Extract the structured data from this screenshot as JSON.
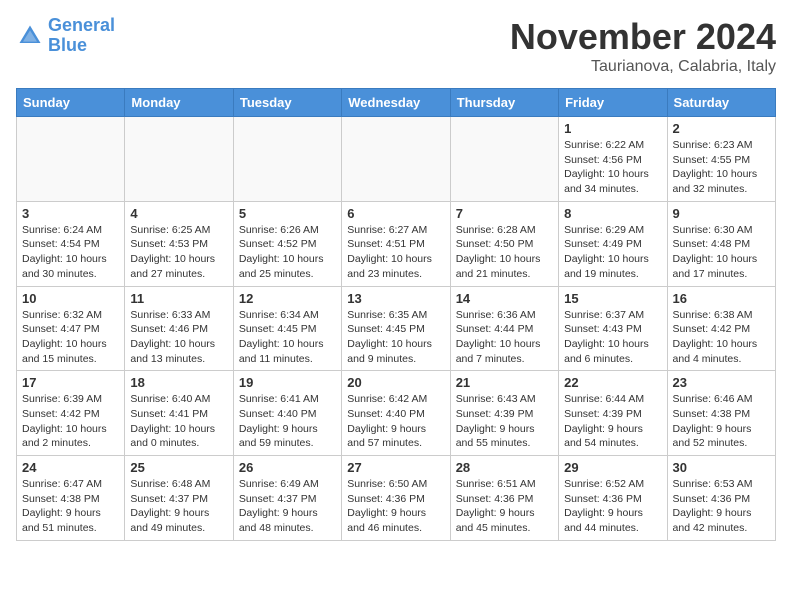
{
  "logo": {
    "line1": "General",
    "line2": "Blue"
  },
  "title": "November 2024",
  "subtitle": "Taurianova, Calabria, Italy",
  "weekdays": [
    "Sunday",
    "Monday",
    "Tuesday",
    "Wednesday",
    "Thursday",
    "Friday",
    "Saturday"
  ],
  "weeks": [
    [
      {
        "day": "",
        "sunrise": "",
        "sunset": "",
        "daylight": ""
      },
      {
        "day": "",
        "sunrise": "",
        "sunset": "",
        "daylight": ""
      },
      {
        "day": "",
        "sunrise": "",
        "sunset": "",
        "daylight": ""
      },
      {
        "day": "",
        "sunrise": "",
        "sunset": "",
        "daylight": ""
      },
      {
        "day": "",
        "sunrise": "",
        "sunset": "",
        "daylight": ""
      },
      {
        "day": "1",
        "sunrise": "Sunrise: 6:22 AM",
        "sunset": "Sunset: 4:56 PM",
        "daylight": "Daylight: 10 hours and 34 minutes."
      },
      {
        "day": "2",
        "sunrise": "Sunrise: 6:23 AM",
        "sunset": "Sunset: 4:55 PM",
        "daylight": "Daylight: 10 hours and 32 minutes."
      }
    ],
    [
      {
        "day": "3",
        "sunrise": "Sunrise: 6:24 AM",
        "sunset": "Sunset: 4:54 PM",
        "daylight": "Daylight: 10 hours and 30 minutes."
      },
      {
        "day": "4",
        "sunrise": "Sunrise: 6:25 AM",
        "sunset": "Sunset: 4:53 PM",
        "daylight": "Daylight: 10 hours and 27 minutes."
      },
      {
        "day": "5",
        "sunrise": "Sunrise: 6:26 AM",
        "sunset": "Sunset: 4:52 PM",
        "daylight": "Daylight: 10 hours and 25 minutes."
      },
      {
        "day": "6",
        "sunrise": "Sunrise: 6:27 AM",
        "sunset": "Sunset: 4:51 PM",
        "daylight": "Daylight: 10 hours and 23 minutes."
      },
      {
        "day": "7",
        "sunrise": "Sunrise: 6:28 AM",
        "sunset": "Sunset: 4:50 PM",
        "daylight": "Daylight: 10 hours and 21 minutes."
      },
      {
        "day": "8",
        "sunrise": "Sunrise: 6:29 AM",
        "sunset": "Sunset: 4:49 PM",
        "daylight": "Daylight: 10 hours and 19 minutes."
      },
      {
        "day": "9",
        "sunrise": "Sunrise: 6:30 AM",
        "sunset": "Sunset: 4:48 PM",
        "daylight": "Daylight: 10 hours and 17 minutes."
      }
    ],
    [
      {
        "day": "10",
        "sunrise": "Sunrise: 6:32 AM",
        "sunset": "Sunset: 4:47 PM",
        "daylight": "Daylight: 10 hours and 15 minutes."
      },
      {
        "day": "11",
        "sunrise": "Sunrise: 6:33 AM",
        "sunset": "Sunset: 4:46 PM",
        "daylight": "Daylight: 10 hours and 13 minutes."
      },
      {
        "day": "12",
        "sunrise": "Sunrise: 6:34 AM",
        "sunset": "Sunset: 4:45 PM",
        "daylight": "Daylight: 10 hours and 11 minutes."
      },
      {
        "day": "13",
        "sunrise": "Sunrise: 6:35 AM",
        "sunset": "Sunset: 4:45 PM",
        "daylight": "Daylight: 10 hours and 9 minutes."
      },
      {
        "day": "14",
        "sunrise": "Sunrise: 6:36 AM",
        "sunset": "Sunset: 4:44 PM",
        "daylight": "Daylight: 10 hours and 7 minutes."
      },
      {
        "day": "15",
        "sunrise": "Sunrise: 6:37 AM",
        "sunset": "Sunset: 4:43 PM",
        "daylight": "Daylight: 10 hours and 6 minutes."
      },
      {
        "day": "16",
        "sunrise": "Sunrise: 6:38 AM",
        "sunset": "Sunset: 4:42 PM",
        "daylight": "Daylight: 10 hours and 4 minutes."
      }
    ],
    [
      {
        "day": "17",
        "sunrise": "Sunrise: 6:39 AM",
        "sunset": "Sunset: 4:42 PM",
        "daylight": "Daylight: 10 hours and 2 minutes."
      },
      {
        "day": "18",
        "sunrise": "Sunrise: 6:40 AM",
        "sunset": "Sunset: 4:41 PM",
        "daylight": "Daylight: 10 hours and 0 minutes."
      },
      {
        "day": "19",
        "sunrise": "Sunrise: 6:41 AM",
        "sunset": "Sunset: 4:40 PM",
        "daylight": "Daylight: 9 hours and 59 minutes."
      },
      {
        "day": "20",
        "sunrise": "Sunrise: 6:42 AM",
        "sunset": "Sunset: 4:40 PM",
        "daylight": "Daylight: 9 hours and 57 minutes."
      },
      {
        "day": "21",
        "sunrise": "Sunrise: 6:43 AM",
        "sunset": "Sunset: 4:39 PM",
        "daylight": "Daylight: 9 hours and 55 minutes."
      },
      {
        "day": "22",
        "sunrise": "Sunrise: 6:44 AM",
        "sunset": "Sunset: 4:39 PM",
        "daylight": "Daylight: 9 hours and 54 minutes."
      },
      {
        "day": "23",
        "sunrise": "Sunrise: 6:46 AM",
        "sunset": "Sunset: 4:38 PM",
        "daylight": "Daylight: 9 hours and 52 minutes."
      }
    ],
    [
      {
        "day": "24",
        "sunrise": "Sunrise: 6:47 AM",
        "sunset": "Sunset: 4:38 PM",
        "daylight": "Daylight: 9 hours and 51 minutes."
      },
      {
        "day": "25",
        "sunrise": "Sunrise: 6:48 AM",
        "sunset": "Sunset: 4:37 PM",
        "daylight": "Daylight: 9 hours and 49 minutes."
      },
      {
        "day": "26",
        "sunrise": "Sunrise: 6:49 AM",
        "sunset": "Sunset: 4:37 PM",
        "daylight": "Daylight: 9 hours and 48 minutes."
      },
      {
        "day": "27",
        "sunrise": "Sunrise: 6:50 AM",
        "sunset": "Sunset: 4:36 PM",
        "daylight": "Daylight: 9 hours and 46 minutes."
      },
      {
        "day": "28",
        "sunrise": "Sunrise: 6:51 AM",
        "sunset": "Sunset: 4:36 PM",
        "daylight": "Daylight: 9 hours and 45 minutes."
      },
      {
        "day": "29",
        "sunrise": "Sunrise: 6:52 AM",
        "sunset": "Sunset: 4:36 PM",
        "daylight": "Daylight: 9 hours and 44 minutes."
      },
      {
        "day": "30",
        "sunrise": "Sunrise: 6:53 AM",
        "sunset": "Sunset: 4:36 PM",
        "daylight": "Daylight: 9 hours and 42 minutes."
      }
    ]
  ]
}
